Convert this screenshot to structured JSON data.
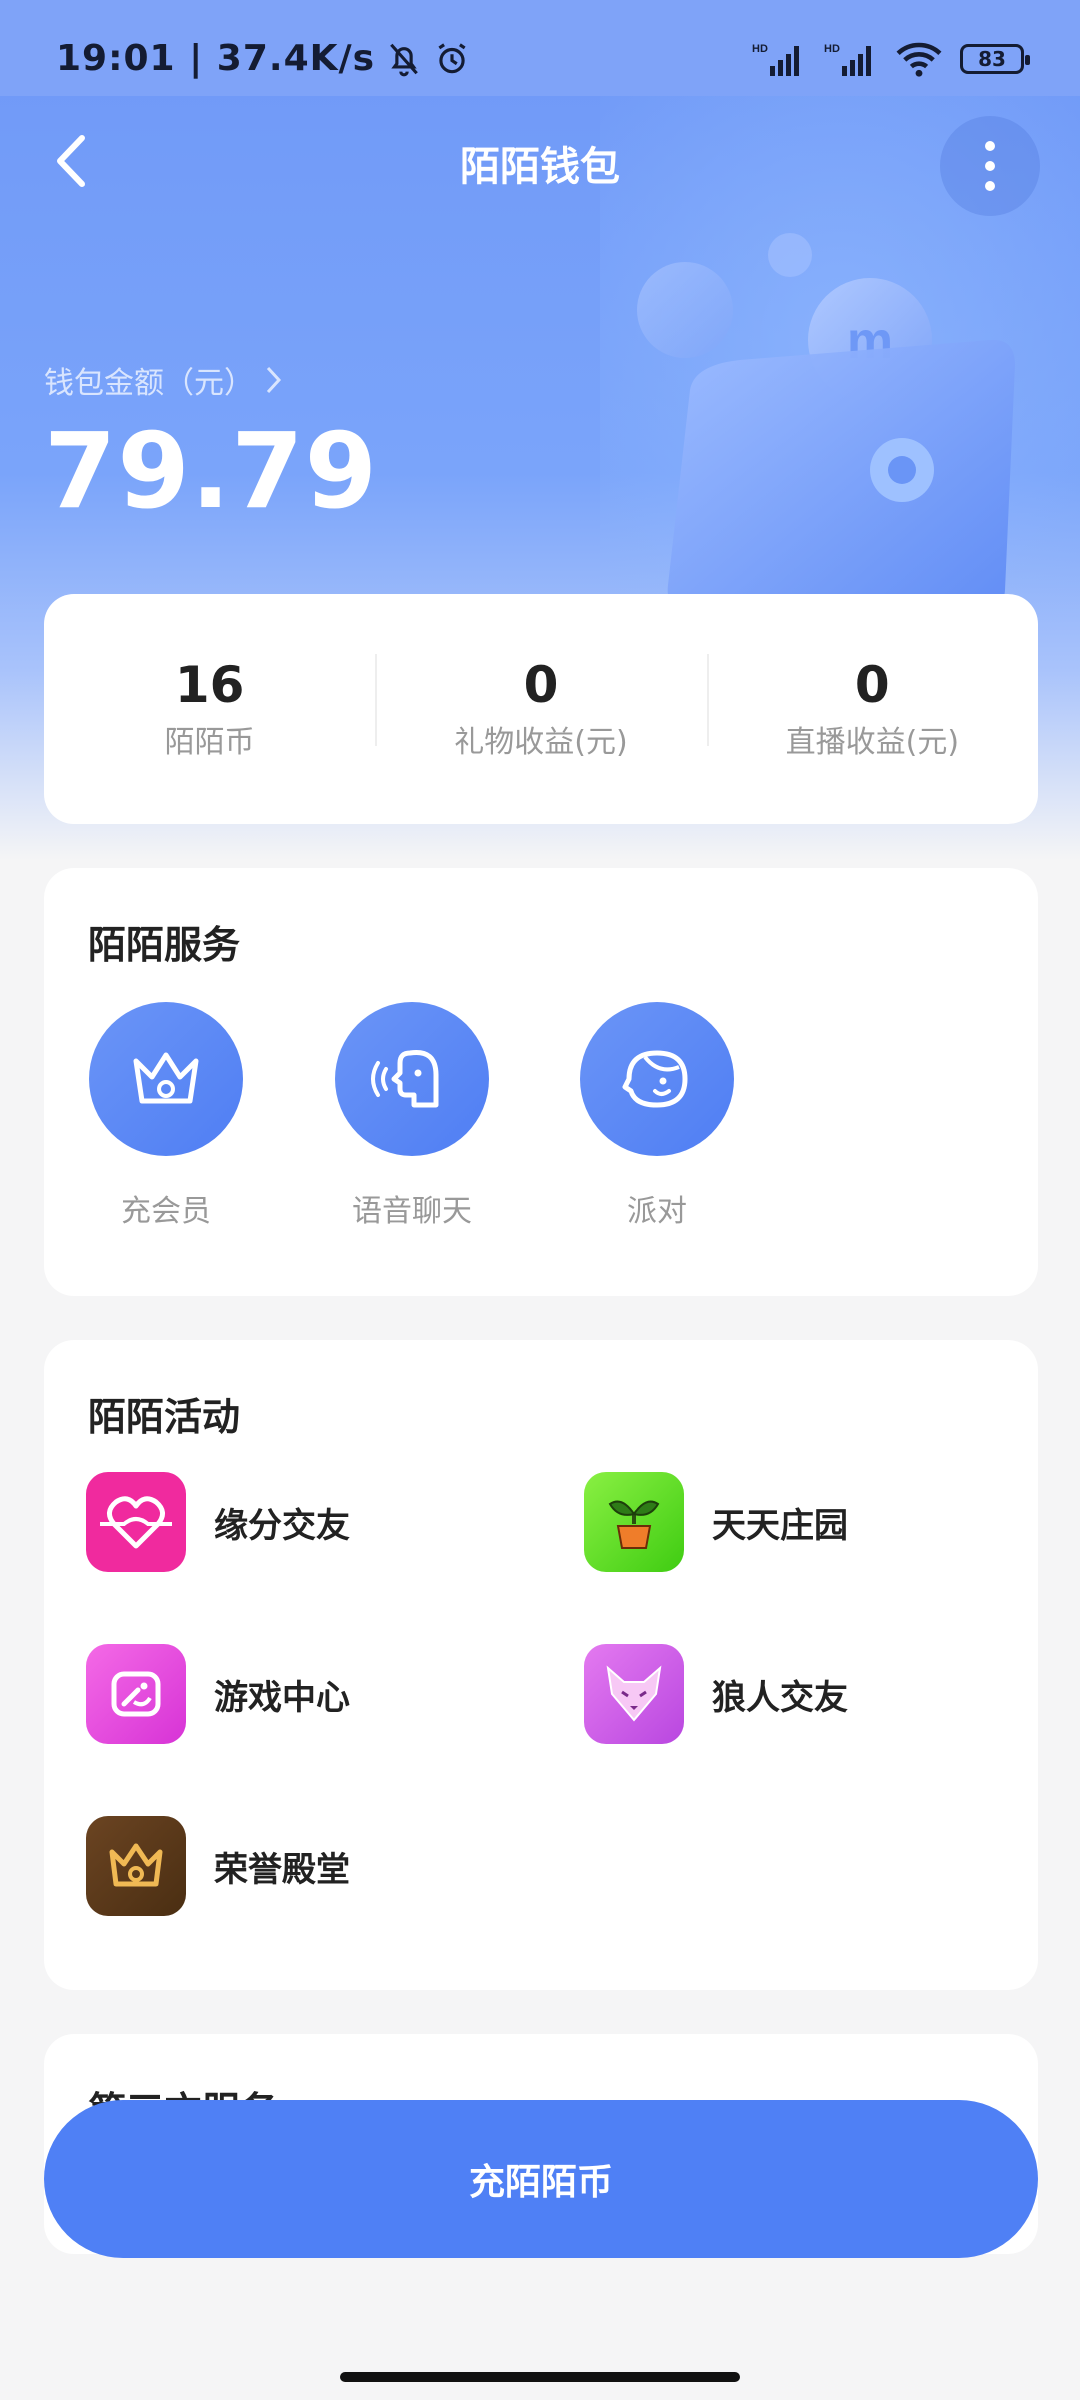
{
  "status_bar": {
    "time_speed": "19:01 | 37.4K/s",
    "battery": "83",
    "network_label": "HD"
  },
  "header": {
    "title": "陌陌钱包",
    "back_icon": "chevron-left-icon",
    "more_icon": "more-vertical-icon"
  },
  "balance": {
    "label": "钱包金额（元）",
    "value": "79.79"
  },
  "stats": [
    {
      "value": "16",
      "label": "陌陌币"
    },
    {
      "value": "0",
      "label": "礼物收益(元)"
    },
    {
      "value": "0",
      "label": "直播收益(元)"
    }
  ],
  "services": {
    "title": "陌陌服务",
    "items": [
      {
        "label": "充会员",
        "icon": "crown-icon"
      },
      {
        "label": "语音聊天",
        "icon": "voice-chat-icon"
      },
      {
        "label": "派对",
        "icon": "party-face-icon"
      }
    ]
  },
  "activities": {
    "title": "陌陌活动",
    "items": [
      {
        "label": "缘分交友",
        "icon": "heart-link-icon",
        "color": "#f02a9e"
      },
      {
        "label": "天天庄园",
        "icon": "sprout-icon",
        "color": "#57d91a"
      },
      {
        "label": "游戏中心",
        "icon": "game-icon",
        "color": "#e94ee0"
      },
      {
        "label": "狼人交友",
        "icon": "wolf-icon",
        "color": "#d55ae8"
      },
      {
        "label": "荣誉殿堂",
        "icon": "crown-icon",
        "color": "#5a3a1c"
      }
    ]
  },
  "third_party": {
    "title": "第三方服务"
  },
  "cta": {
    "label": "充陌陌币"
  },
  "colors": {
    "primary": "#4f80f5",
    "hero": "#7aa4fa"
  }
}
